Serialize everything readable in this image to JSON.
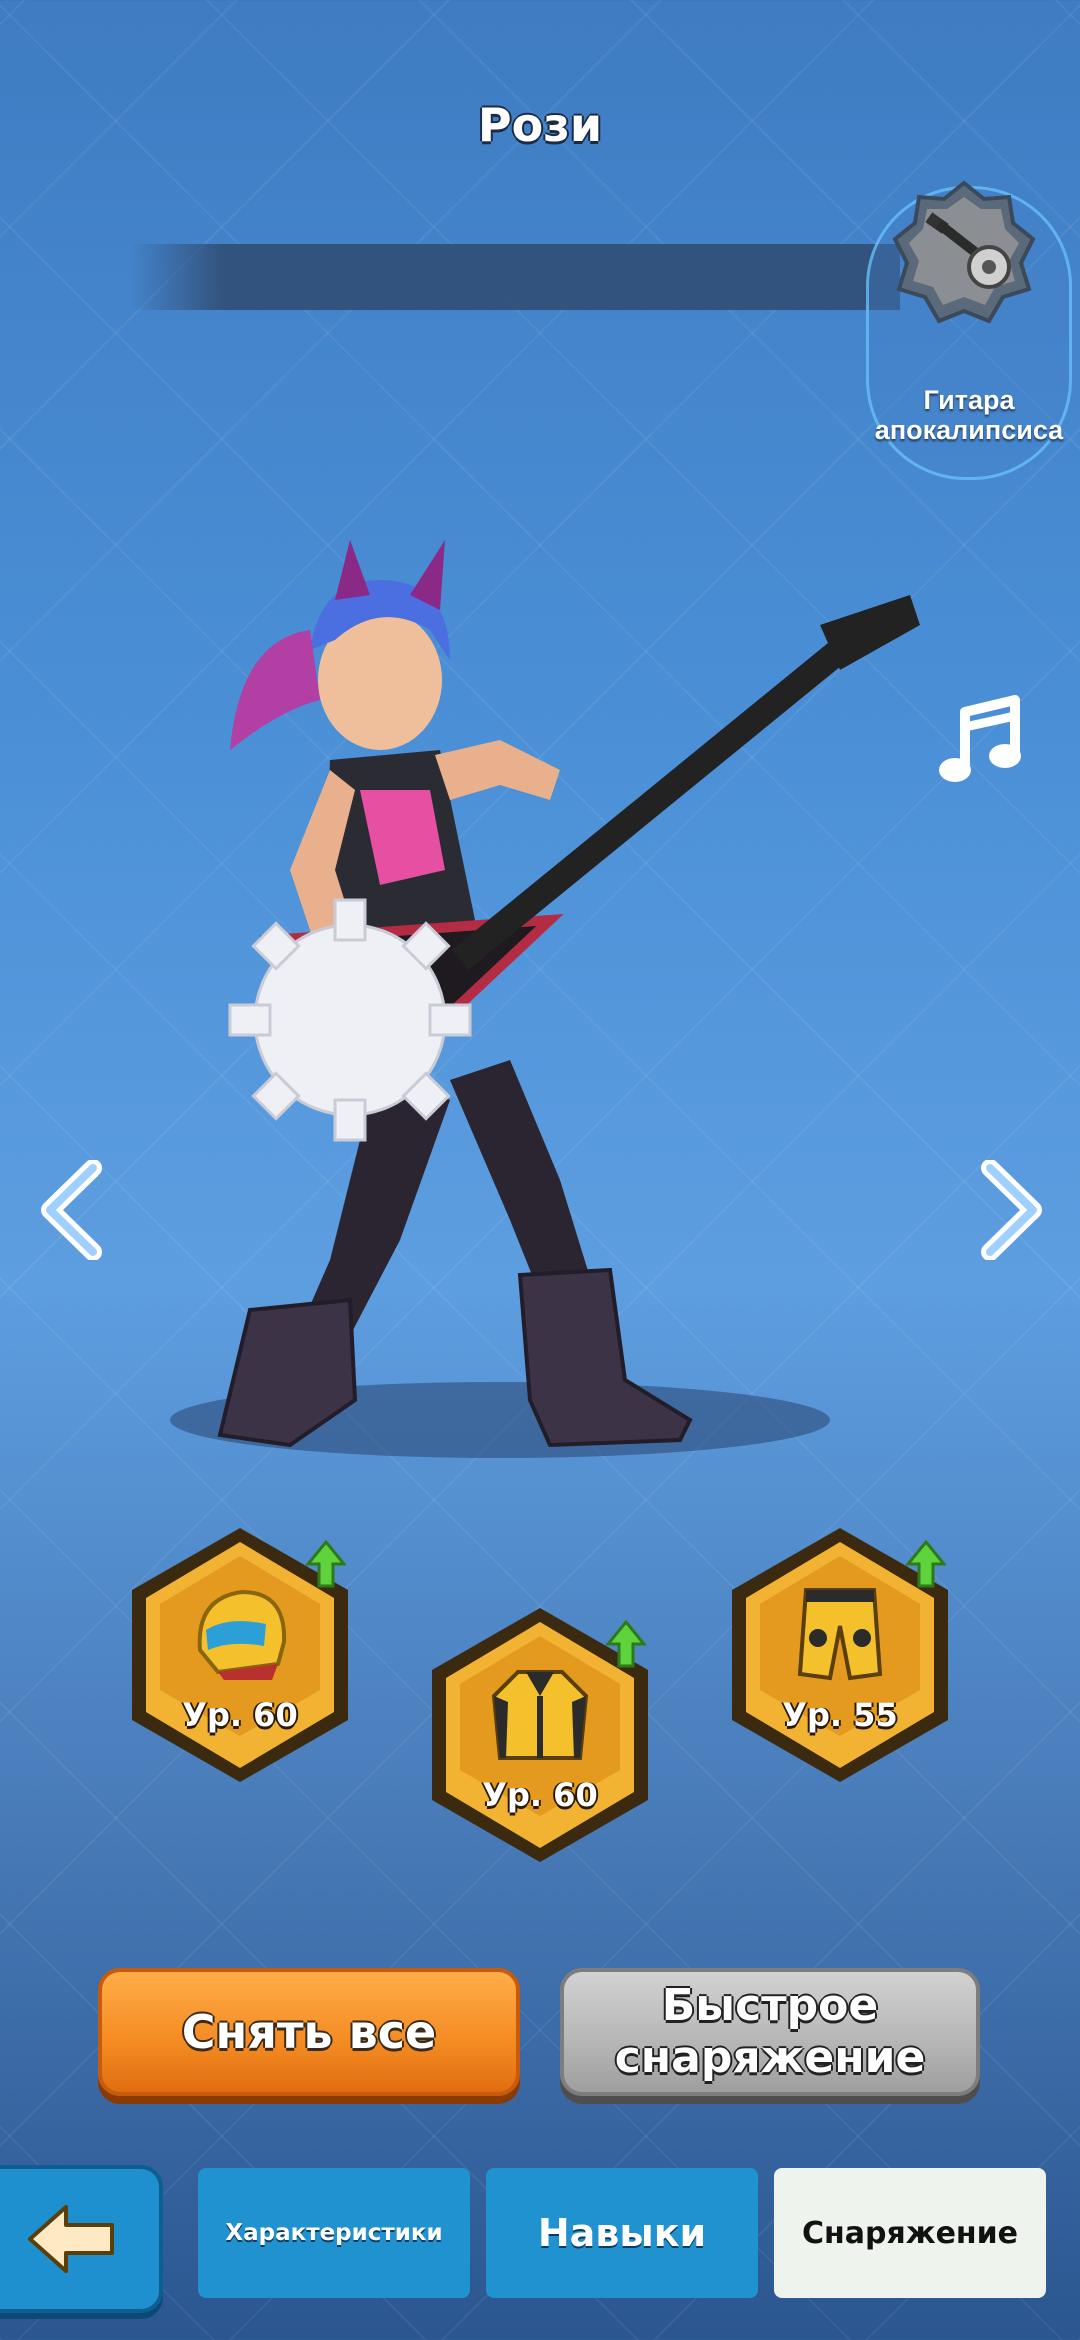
{
  "hero": {
    "name": "Рози"
  },
  "weapon": {
    "label": "Гитара апокалипсиса",
    "icon": "guitar-saw-icon"
  },
  "gear": [
    {
      "slot": "helmet",
      "icon": "helmet-icon",
      "level_text": "Ур. 60",
      "upgrade_available": true
    },
    {
      "slot": "armor",
      "icon": "jacket-icon",
      "level_text": "Ур. 60",
      "upgrade_available": true
    },
    {
      "slot": "pants",
      "icon": "pants-icon",
      "level_text": "Ур. 55",
      "upgrade_available": true
    }
  ],
  "actions": {
    "remove_all": "Снять все",
    "quick_equip": "Быстрое снаряжение"
  },
  "tabs": [
    {
      "label": "Характеристики",
      "active": false
    },
    {
      "label": "Навыки",
      "active": false
    },
    {
      "label": "Снаряжение",
      "active": true
    }
  ],
  "colors": {
    "accent_orange": "#f48a22",
    "tab_blue": "#1f92cf",
    "gear_gold": "#f2b232",
    "upgrade_green": "#5fd33c"
  }
}
